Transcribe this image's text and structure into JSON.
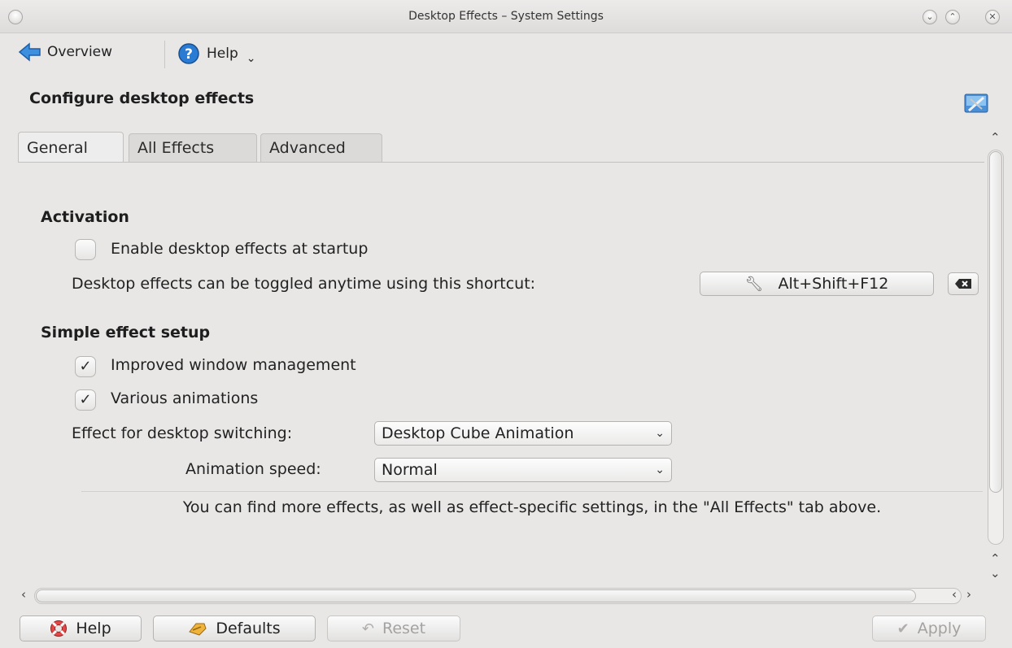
{
  "window": {
    "title": "Desktop Effects – System Settings"
  },
  "toolbar": {
    "overview_label": "Overview",
    "help_label": "Help"
  },
  "page": {
    "title": "Configure desktop effects"
  },
  "tabs": [
    {
      "label": "General",
      "active": true
    },
    {
      "label": "All Effects",
      "active": false
    },
    {
      "label": "Advanced",
      "active": false
    }
  ],
  "activation": {
    "heading": "Activation",
    "enable_startup_label": "Enable desktop effects at startup",
    "enable_startup_checked": false,
    "shortcut_label": "Desktop effects can be toggled anytime using this shortcut:",
    "shortcut_value": "Alt+Shift+F12"
  },
  "simple_setup": {
    "heading": "Simple effect setup",
    "improved_wm_label": "Improved window management",
    "improved_wm_checked": true,
    "animations_label": "Various animations",
    "animations_checked": true,
    "switching_label": "Effect for desktop switching:",
    "switching_value": "Desktop Cube Animation",
    "speed_label": "Animation speed:",
    "speed_value": "Normal"
  },
  "info_text": "You can find more effects, as well as effect-specific settings, in the \"All Effects\" tab above.",
  "buttons": {
    "help": "Help",
    "defaults": "Defaults",
    "reset": "Reset",
    "apply": "Apply"
  },
  "colors": {
    "background": "#e8e7e6",
    "help_blue": "#2a7bd4",
    "disabled_text": "#a4a2a0"
  }
}
